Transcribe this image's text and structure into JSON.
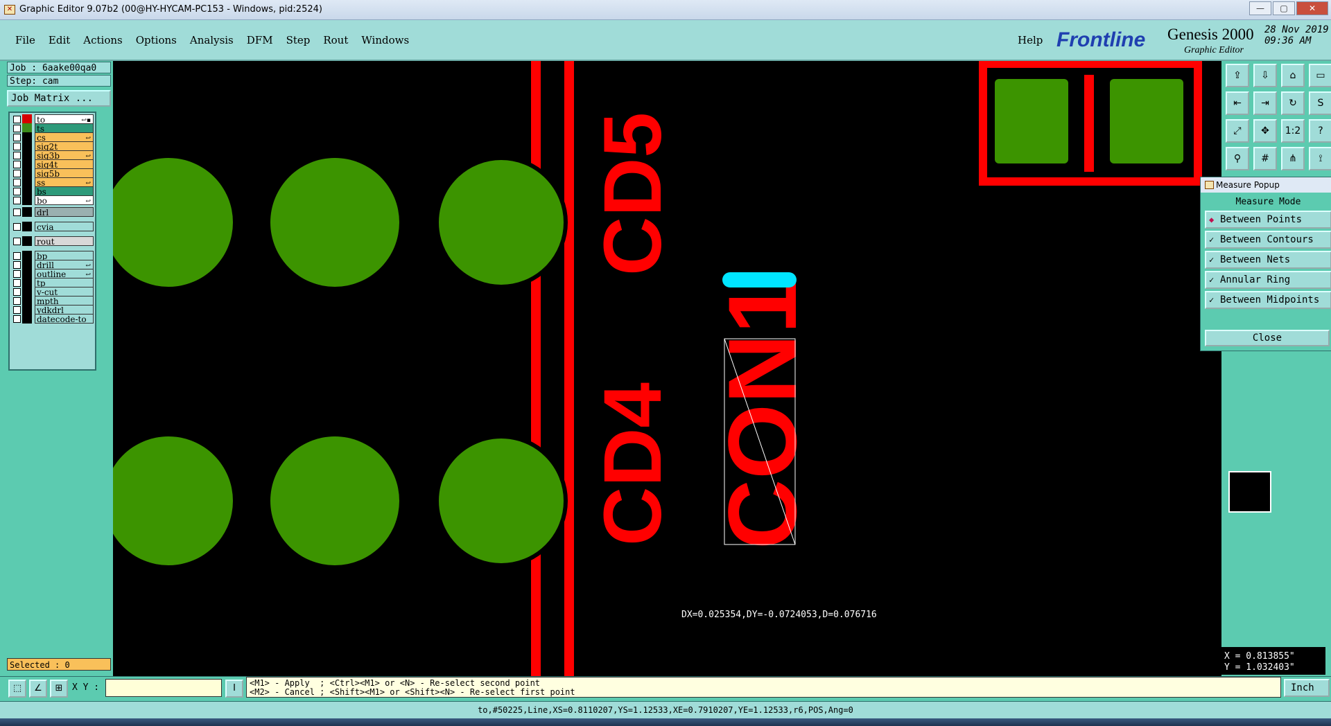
{
  "window": {
    "title": "Graphic Editor 9.07b2 (00@HY-HYCAM-PC153 - Windows, pid:2524)",
    "min": "—",
    "max": "▢",
    "close": "✕"
  },
  "menu": {
    "items": [
      "File",
      "Edit",
      "Actions",
      "Options",
      "Analysis",
      "DFM",
      "Step",
      "Rout",
      "Windows"
    ],
    "help": "Help"
  },
  "logo": {
    "brand": "Frontline",
    "product": "Genesis 2000",
    "subtitle": "Graphic Editor",
    "date": "28 Nov 2019",
    "time": "09:36 AM"
  },
  "job": {
    "job_label": "Job : 6aake00qa0",
    "step_label": "Step: cam",
    "matrix_button": "Job Matrix ..."
  },
  "layers": [
    {
      "name": "to",
      "color": "#ffffff",
      "swatch": "#d60000",
      "mark": "↩▪"
    },
    {
      "name": "ts",
      "color": "#2e9a7a",
      "swatch": "#3c8c1c",
      "mark": ""
    },
    {
      "name": "cs",
      "color": "#f9c05a",
      "swatch": "#000000",
      "mark": "↩"
    },
    {
      "name": "sig2t",
      "color": "#f9c05a",
      "swatch": "#000000",
      "mark": ""
    },
    {
      "name": "sig3b",
      "color": "#f9c05a",
      "swatch": "#000000",
      "mark": "↩"
    },
    {
      "name": "sig4t",
      "color": "#f9c05a",
      "swatch": "#000000",
      "mark": ""
    },
    {
      "name": "sig5b",
      "color": "#f9c05a",
      "swatch": "#000000",
      "mark": ""
    },
    {
      "name": "ss",
      "color": "#f9c05a",
      "swatch": "#000000",
      "mark": "↩"
    },
    {
      "name": "bs",
      "color": "#2e9a7a",
      "swatch": "#000000",
      "mark": ""
    },
    {
      "name": "bo",
      "color": "#ffffff",
      "swatch": "#000000",
      "mark": "↩"
    },
    {
      "name": "drl",
      "color": "#9ab0b0",
      "swatch": "#000000",
      "mark": ""
    },
    {
      "name": "cvia",
      "color": "#a0dcd8",
      "swatch": "#000000",
      "mark": ""
    },
    {
      "name": "rout",
      "color": "#d8d8d8",
      "swatch": "#000000",
      "mark": ""
    },
    {
      "name": "bp",
      "color": "#a0dcd8",
      "swatch": "#000000",
      "mark": ""
    },
    {
      "name": "drill",
      "color": "#a0dcd8",
      "swatch": "#000000",
      "mark": "↩"
    },
    {
      "name": "outline",
      "color": "#a0dcd8",
      "swatch": "#000000",
      "mark": "↩"
    },
    {
      "name": "tp",
      "color": "#a0dcd8",
      "swatch": "#000000",
      "mark": ""
    },
    {
      "name": "v-cut",
      "color": "#a0dcd8",
      "swatch": "#000000",
      "mark": ""
    },
    {
      "name": "mpth",
      "color": "#a0dcd8",
      "swatch": "#000000",
      "mark": ""
    },
    {
      "name": "ydkdrl",
      "color": "#a0dcd8",
      "swatch": "#000000",
      "mark": ""
    },
    {
      "name": "datecode-to",
      "color": "#a0dcd8",
      "swatch": "#000000",
      "mark": ""
    }
  ],
  "selected": "Selected : 0",
  "measure": {
    "title": "Measure Popup",
    "mode_label": "Measure Mode",
    "options": [
      "Between Points",
      "Between Contours",
      "Between Nets",
      "Annular Ring",
      "Between Midpoints"
    ],
    "active_index": 0,
    "close": "Close"
  },
  "canvas": {
    "labels": [
      "CD5",
      "CD4",
      "CON1"
    ],
    "readout": "DX=0.025354,DY=-0.0724053,D=0.076716"
  },
  "coords": {
    "x": "X = 0.813855\"",
    "y": "Y = 1.032403\""
  },
  "bottom": {
    "xy_label": "X Y :",
    "xy_value": "",
    "hint_line1": "<M1> - Apply  ; <Ctrl><M1> or <N> - Re-select second point",
    "hint_line2": "<M2> - Cancel ; <Shift><M1> or <Shift><N> - Re-select first point",
    "units": "Inch"
  },
  "status": "to,#50225,Line,XS=0.8110207,YS=1.12533,XE=0.7910207,YE=1.12533,r6,POS,Ang=0",
  "colors": {
    "panel": "#5ccbb0",
    "menu": "#a0dcd8",
    "copper": "#ff0000",
    "pad": "#3c9400",
    "highlight": "#00e5ff"
  }
}
